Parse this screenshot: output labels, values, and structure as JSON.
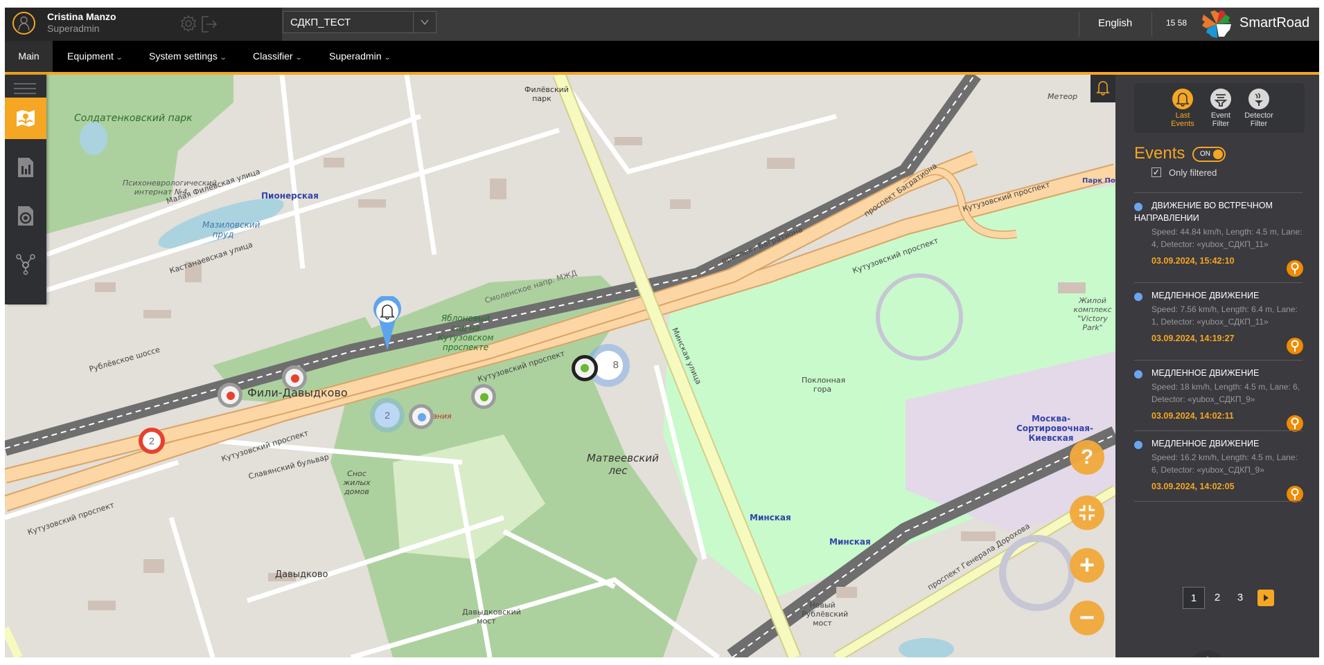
{
  "header": {
    "user_name": "Cristina Manzo",
    "user_role": "Superadmin",
    "organization_select": "СДКП_ТЕСТ",
    "language": "English",
    "clock": "15 58",
    "brand": "SmartRoad",
    "icons": [
      "user-icon",
      "gear-icon",
      "logout-icon",
      "chevron-down-icon",
      "smartroad-logo"
    ]
  },
  "nav": {
    "items": [
      {
        "label": "Main",
        "active": true,
        "dropdown": false
      },
      {
        "label": "Equipment",
        "active": false,
        "dropdown": true
      },
      {
        "label": "System settings",
        "active": false,
        "dropdown": true
      },
      {
        "label": "Classifier",
        "active": false,
        "dropdown": true
      },
      {
        "label": "Superadmin",
        "active": false,
        "dropdown": true
      }
    ],
    "accent_color": "#f5a623"
  },
  "sidebar": {
    "items": [
      {
        "icon": "map-icon",
        "active": true
      },
      {
        "icon": "report-chart-icon",
        "active": false
      },
      {
        "icon": "camera-file-icon",
        "active": false
      },
      {
        "icon": "network-topology-icon",
        "active": false
      }
    ]
  },
  "map": {
    "labels": {
      "soldatenkovsky": "Солдатенковский парк",
      "internat": "Психоневрологический интернат №4",
      "pionerskaya": "Пионерская",
      "mazilovsky": "Мазиловский пруд",
      "malaya_filevskaya": "Малая Филёвская улица",
      "kastanaevskaya": "Кастанаевская улица",
      "rublevskoe": "Рублёвское шоссе",
      "fili_davydkovo": "Фили-Давыдково",
      "kutuzovsky1": "Кутузовский проспект",
      "kutuzovsky2": "Кутузовский проспект",
      "kutuzovsky3": "Кутузовский проспект",
      "kutuzovsky4": "Кутузовский проспект",
      "bagrationa1": "проспект Багратиона",
      "bagrationa2": "проспект Багратиона",
      "smolenskoe": "Смоленское напр. МЖД",
      "yablonevy": "Яблоневый сад на Кутузовском проспекте",
      "matveevsky": "Матвеевский лес",
      "poklonnaya": "Поклонная гора",
      "minskaya_street": "Минская улица",
      "minskaya1": "Минская",
      "minskaya2": "Минская",
      "davydkovo": "Давыдково",
      "filevsky_park": "Филёвский парк",
      "moskva_sort": "Москва-Сортировочная-Киевская",
      "victory_park": "Жилой комплекс \"Victory Park\"",
      "park_pobedy": "Парк Победы",
      "generala_dorokhova": "проспект Генерала Дорохова",
      "slavyansky": "Славянский бульвар",
      "davydkovsky_most": "Давыдковский мост",
      "novy_rublevsky": "Новый Рублёвский мост",
      "okeania": "Океания",
      "meteor": "Метеор",
      "snos": "Снос жилых домов"
    },
    "markers": [
      {
        "type": "cluster",
        "count": "2",
        "color": "#e8412c"
      },
      {
        "type": "detector",
        "status_color": "#e8412c"
      },
      {
        "type": "detector",
        "status_color": "#e8412c"
      },
      {
        "type": "cluster-selected",
        "count": "2",
        "color": "#6aa6ee",
        "pin_icon": "bell-icon"
      },
      {
        "type": "detector",
        "status_color": "#6aa6ee"
      },
      {
        "type": "detector",
        "status_color": "#6ab82e"
      },
      {
        "type": "detector-selected",
        "status_color": "#6ab82e"
      },
      {
        "type": "cluster",
        "count": "8",
        "color": "#6aa6ee"
      }
    ],
    "controls": [
      {
        "label": "?",
        "icon": "help-icon"
      },
      {
        "label": "",
        "icon": "fit-screen-icon"
      },
      {
        "label": "+",
        "icon": "zoom-in-icon"
      },
      {
        "label": "−",
        "icon": "zoom-out-icon"
      }
    ]
  },
  "panel": {
    "tabs": [
      {
        "label": "Last Events",
        "icon": "bell-icon",
        "active": true
      },
      {
        "label": "Event Filter",
        "icon": "filter-icon",
        "active": false
      },
      {
        "label": "Detector Filter",
        "icon": "detector-filter-icon",
        "active": false
      }
    ],
    "events_title": "Events",
    "toggle_label": "ON",
    "toggle_on": true,
    "only_filtered_label": "Only filtered",
    "only_filtered_checked": true,
    "events": [
      {
        "title": "ДВИЖЕНИЕ ВО ВСТРЕЧНОМ НАПРАВЛЕНИИ",
        "desc": "Speed: 44.84 km/h, Length: 4.5 m, Lane: 4, Detector: «yubox_СДКП_11»",
        "time": "03.09.2024, 15:42:10"
      },
      {
        "title": "МЕДЛЕННОЕ ДВИЖЕНИЕ",
        "desc": "Speed: 7.56 km/h, Length: 6.4 m, Lane: 1, Detector: «yubox_СДКП_11»",
        "time": "03.09.2024, 14:19:27"
      },
      {
        "title": "МЕДЛЕННОЕ ДВИЖЕНИЕ",
        "desc": "Speed: 18 km/h, Length: 4.5 m, Lane: 6, Detector: «yubox_СДКП_9»",
        "time": "03.09.2024, 14:02:11"
      },
      {
        "title": "МЕДЛЕННОЕ ДВИЖЕНИЕ",
        "desc": "Speed: 16.2 km/h, Length: 4.5 m, Lane: 6, Detector: «yubox_СДКП_9»",
        "time": "03.09.2024, 14:02:05"
      }
    ],
    "pagination": {
      "pages": [
        "1",
        "2",
        "3"
      ],
      "current": "1",
      "next_icon": "play-next-icon"
    }
  }
}
